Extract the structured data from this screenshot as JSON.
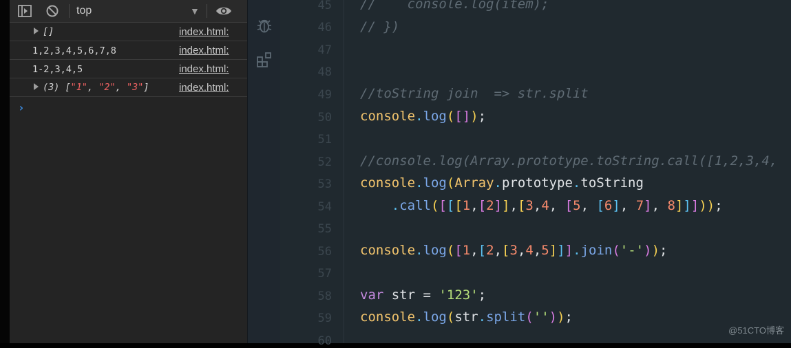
{
  "devtools": {
    "context": "top",
    "rows": [
      {
        "type": "expandable",
        "text": "[]",
        "source": "index.html:"
      },
      {
        "type": "plain",
        "text": "1,2,3,4,5,6,7,8",
        "source": "index.html:"
      },
      {
        "type": "plain",
        "text": "1-2,3,4,5",
        "source": "index.html:"
      },
      {
        "type": "array",
        "prefix": "(3) [",
        "items": [
          "\"1\"",
          "\"2\"",
          "\"3\""
        ],
        "suffix": "]",
        "source": "index.html:"
      }
    ],
    "prompt": "›"
  },
  "editor": {
    "line_numbers": [
      "45",
      "46",
      "47",
      "48",
      "49",
      "50",
      "51",
      "52",
      "53",
      "54",
      "55",
      "56",
      "57",
      "58",
      "59",
      "60"
    ],
    "lines": [
      "//    console.log(item);",
      "// })",
      "",
      "",
      "//toString join  => str.split",
      "console.log([]);",
      "",
      "//console.log(Array.prototype.toString.call([1,2,3,4,",
      "console.log(Array.prototype.toString",
      "    .call([[[1,[2]],[3,4, [5, [6], 7], 8]]]));",
      "",
      "console.log([1,[2,[3,4,5]]].join('-'));",
      "",
      "var str = '123';",
      "console.log(str.split(''));",
      ""
    ]
  },
  "watermark": "@51CTO博客"
}
